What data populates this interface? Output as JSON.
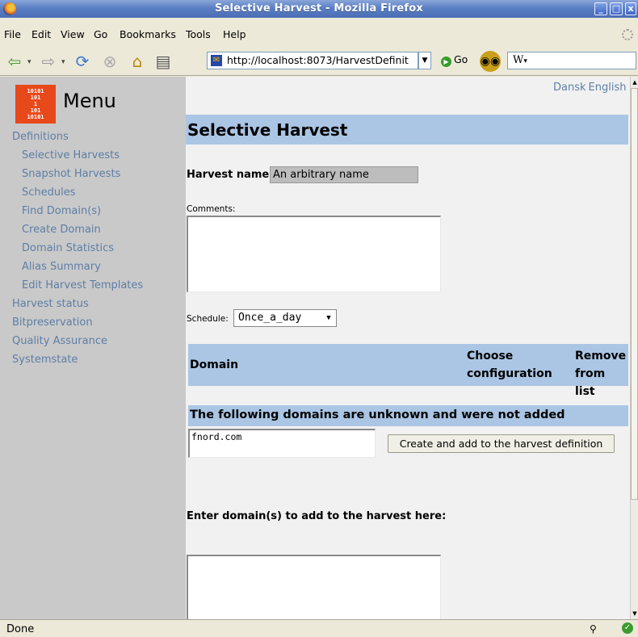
{
  "window": {
    "title": "Selective Harvest - Mozilla Firefox",
    "controls": [
      "_",
      "□",
      "x"
    ]
  },
  "menubar": [
    "File",
    "Edit",
    "View",
    "Go",
    "Bookmarks",
    "Tools",
    "Help"
  ],
  "toolbar": {
    "url": "http://localhost:8073/HarvestDefinit",
    "go_label": "Go",
    "search_text": "W"
  },
  "sidebar": {
    "title": "Menu",
    "logo_bits": [
      "10101",
      "101",
      "1",
      "101",
      "10101"
    ],
    "items": [
      {
        "label": "Definitions",
        "level": "top"
      },
      {
        "label": "Selective Harvests",
        "level": "sub"
      },
      {
        "label": "Snapshot Harvests",
        "level": "sub"
      },
      {
        "label": "Schedules",
        "level": "sub"
      },
      {
        "label": "Find Domain(s)",
        "level": "sub"
      },
      {
        "label": "Create Domain",
        "level": "sub"
      },
      {
        "label": "Domain Statistics",
        "level": "sub"
      },
      {
        "label": "Alias Summary",
        "level": "sub"
      },
      {
        "label": "Edit Harvest Templates",
        "level": "sub"
      },
      {
        "label": "Harvest status",
        "level": "top"
      },
      {
        "label": "Bitpreservation",
        "level": "top"
      },
      {
        "label": "Quality Assurance",
        "level": "top"
      },
      {
        "label": "Systemstate",
        "level": "top"
      }
    ]
  },
  "lang": {
    "dansk": "Dansk",
    "english": "English"
  },
  "main": {
    "heading": "Selective Harvest",
    "harvest_name_label": "Harvest name:",
    "harvest_name_value": "An arbitrary name",
    "comments_label": "Comments:",
    "schedule_label": "Schedule:",
    "schedule_value": "Once_a_day",
    "table_headers": {
      "domain": "Domain",
      "choose_1": "Choose",
      "choose_2": "configuration",
      "remove_1": "Remove",
      "remove_2": "from list"
    },
    "unknown_heading": "The following domains are unknown and were not added",
    "unknown_value": "fnord.com",
    "create_add_button": "Create and add to the harvest definition",
    "enter_domains_label": "Enter domain(s) to add to the harvest here:"
  },
  "status": {
    "text": "Done"
  }
}
